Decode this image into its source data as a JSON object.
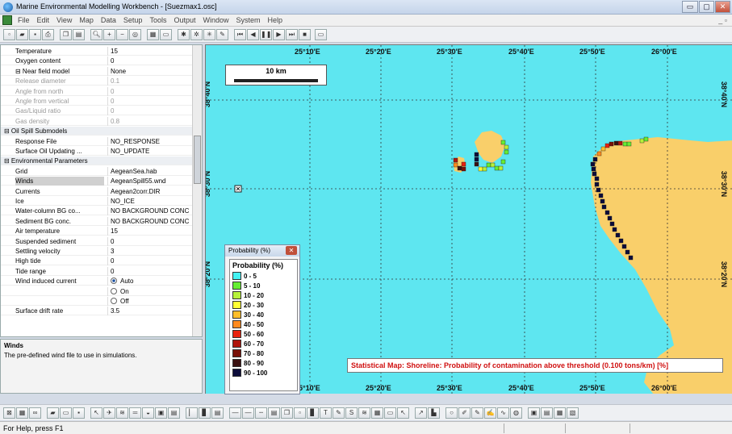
{
  "window": {
    "title": "Marine Environmental Modelling Workbench - [Suezmax1.osc]",
    "buttons": [
      "▭",
      "▢",
      "✕"
    ]
  },
  "menu": {
    "items": [
      "File",
      "Edit",
      "View",
      "Map",
      "Data",
      "Setup",
      "Tools",
      "Output",
      "Window",
      "System",
      "Help"
    ],
    "mdi_controls": "_ ▫"
  },
  "properties": {
    "rows": [
      {
        "key": "Temperature",
        "value": "15",
        "type": "normal"
      },
      {
        "key": "Oxygen content",
        "value": "0",
        "type": "normal"
      },
      {
        "key": "⊟ Near field model",
        "value": "None",
        "type": "normal"
      },
      {
        "key": "Release diameter",
        "value": "0.1",
        "type": "disabled"
      },
      {
        "key": "Angle from north",
        "value": "0",
        "type": "disabled"
      },
      {
        "key": "Angle from vertical",
        "value": "0",
        "type": "disabled"
      },
      {
        "key": "Gas/Liquid ratio",
        "value": "0",
        "type": "disabled"
      },
      {
        "key": "Gas density",
        "value": "0.8",
        "type": "disabled"
      },
      {
        "key": "⊟ Oil Spill Submodels",
        "value": "",
        "type": "category"
      },
      {
        "key": "Response File",
        "value": "NO_RESPONSE",
        "type": "normal"
      },
      {
        "key": "Surface Oil Updating ...",
        "value": "NO_UPDATE",
        "type": "normal"
      },
      {
        "key": "⊟ Environmental Parameters",
        "value": "",
        "type": "category"
      },
      {
        "key": "Grid",
        "value": "AegeanSea.hab",
        "type": "normal"
      },
      {
        "key": "Winds",
        "value": "AegeanSpill55.wnd",
        "type": "selected"
      },
      {
        "key": "Currents",
        "value": "Aegean2corr.DIR",
        "type": "normal"
      },
      {
        "key": "Ice",
        "value": "NO_ICE",
        "type": "normal"
      },
      {
        "key": "Water-column BG co...",
        "value": "NO BACKGROUND CONC",
        "type": "normal"
      },
      {
        "key": "Sediment BG conc.",
        "value": "NO BACKGROUND CONC",
        "type": "normal"
      },
      {
        "key": "Air temperature",
        "value": "15",
        "type": "normal"
      },
      {
        "key": "Suspended sediment",
        "value": "0",
        "type": "normal"
      },
      {
        "key": "Settling velocity",
        "value": "3",
        "type": "normal"
      },
      {
        "key": "High tide",
        "value": "0",
        "type": "normal"
      },
      {
        "key": "Tide range",
        "value": "0",
        "type": "normal"
      },
      {
        "key": "Wind induced current",
        "value": "Auto",
        "type": "radio-on"
      },
      {
        "key": "",
        "value": "On",
        "type": "radio"
      },
      {
        "key": "",
        "value": "Off",
        "type": "radio"
      },
      {
        "key": "Surface drift rate",
        "value": "3.5",
        "type": "normal"
      }
    ]
  },
  "description": {
    "title": "Winds",
    "text": "The pre-defined wind file to use in simulations."
  },
  "map": {
    "lon_labels_top": [
      "25°10'E",
      "25°20'E",
      "25°30'E",
      "25°40'E",
      "25°50'E",
      "26°00'E"
    ],
    "lon_labels_bottom": [
      "25°10'E",
      "25°20'E",
      "25°30'E",
      "25°40'E",
      "25°50'E",
      "26°00'E"
    ],
    "lat_labels": [
      "38°40'N",
      "38°30'N",
      "38°20'N"
    ],
    "scale": "10 km",
    "water_color": "#5ee6f0",
    "land_color": "#f9cf6a",
    "statistical_title": "Statistical Map: Shoreline: Probability of contamination above threshold (0.100 tons/km) [%]"
  },
  "legend": {
    "window_title": "Probability (%)",
    "title": "Probability (%)",
    "items": [
      {
        "label": "0 - 5",
        "color": "#44f2f2"
      },
      {
        "label": "5 - 10",
        "color": "#66ee33"
      },
      {
        "label": "10 - 20",
        "color": "#b6f23a"
      },
      {
        "label": "20 - 30",
        "color": "#ffff33"
      },
      {
        "label": "30 - 40",
        "color": "#ffbe2a"
      },
      {
        "label": "40 - 50",
        "color": "#ff8a1e"
      },
      {
        "label": "50 - 60",
        "color": "#e8220e"
      },
      {
        "label": "60 - 70",
        "color": "#b0140c"
      },
      {
        "label": "70 - 80",
        "color": "#7a1008"
      },
      {
        "label": "80 - 90",
        "color": "#3a1010"
      },
      {
        "label": "90 - 100",
        "color": "#0c0c3a"
      }
    ]
  },
  "status": {
    "help": "For Help, press F1"
  }
}
